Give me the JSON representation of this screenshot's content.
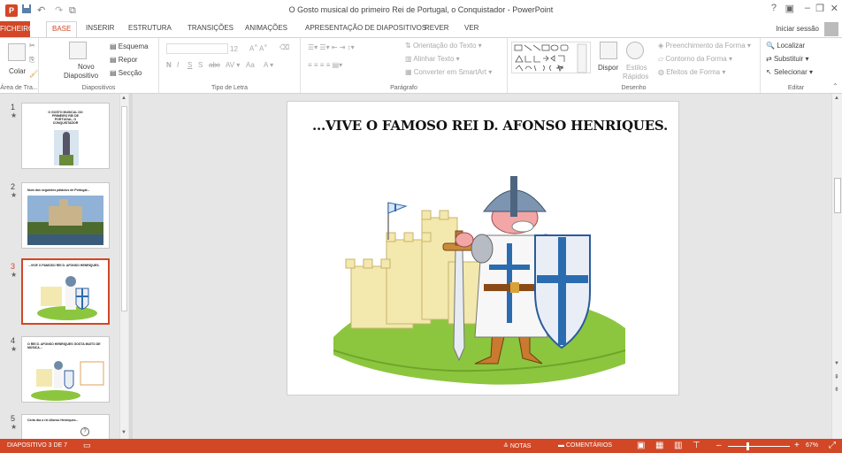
{
  "window": {
    "title": "O Gosto musical do primeiro Rei de Portugal, o Conquistador - PowerPoint",
    "help": "?",
    "sign_in": "Iniciar sessão"
  },
  "tabs": [
    "FICHEIRO",
    "BASE",
    "INSERIR",
    "ESTRUTURA",
    "TRANSIÇÕES",
    "ANIMAÇÕES",
    "APRESENTAÇÃO DE DIAPOSITIVOS",
    "REVER",
    "VER"
  ],
  "ribbon": {
    "clipboard": {
      "label": "Área de Tra...",
      "paste": "Colar"
    },
    "slides": {
      "label": "Diapositivos",
      "new_slide_1": "Novo",
      "new_slide_2": "Diapositivo",
      "layout": "Esquema",
      "reset": "Repor",
      "section": "Secção"
    },
    "font": {
      "label": "Tipo de Letra",
      "size": "12",
      "bold": "N",
      "italic": "I",
      "underline": "S",
      "shadow": "S",
      "strike": "abc",
      "aa": "Aa"
    },
    "paragraph": {
      "label": "Parágrafo",
      "text_direction": "Orientação do Texto",
      "align_text": "Alinhar Texto",
      "smartart": "Converter em SmartArt"
    },
    "drawing": {
      "label": "Desenho",
      "arrange": "Dispor",
      "quick_styles_1": "Estilos",
      "quick_styles_2": "Rápidos",
      "fill": "Preenchimento da Forma",
      "outline": "Contorno da Forma",
      "effects": "Efeitos de Forma"
    },
    "editing": {
      "label": "Editar",
      "find": "Localizar",
      "replace": "Substituir",
      "select": "Selecionar"
    }
  },
  "thumbnails": [
    {
      "num": "1",
      "star": "★",
      "caption": "O GOSTO MUSICAL DO PRIMEIRO REI DE PORTUGAL, O CONQUISTADOR"
    },
    {
      "num": "2",
      "star": "★",
      "caption": "Num dos seguintes palácios de Portugal..."
    },
    {
      "num": "3",
      "star": "★",
      "caption": "...VIVE O FAMOSO REI D. AFONSO HENRIQUES."
    },
    {
      "num": "4",
      "star": "★",
      "caption": "O REI D. AFONSO HENRIQUES GOSTA MUITO DE MÚSICA..."
    },
    {
      "num": "5",
      "star": "★",
      "caption": "Certo dia o rei Afonso Henriques..."
    }
  ],
  "slide": {
    "title": "...VIVE O FAMOSO REI D. AFONSO HENRIQUES."
  },
  "status": {
    "slide_counter": "DIAPOSITIVO 3 DE 7",
    "notes": "NOTAS",
    "comments": "COMENTÁRIOS",
    "zoom_pct": 67,
    "zoom_label": "67%"
  },
  "colors": {
    "accent": "#d24726"
  }
}
